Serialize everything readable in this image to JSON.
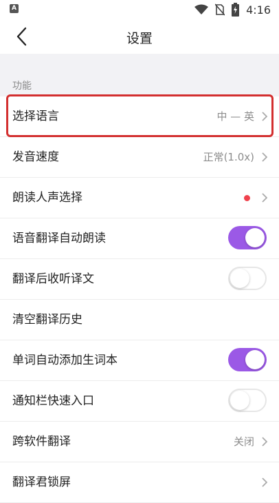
{
  "status_bar": {
    "left_icon_text": "A",
    "icons": [
      "wifi-icon",
      "no-sim-icon",
      "battery-charging-icon"
    ],
    "time": "4:16"
  },
  "header": {
    "title": "设置",
    "back_icon": "chevron-left-icon"
  },
  "section": {
    "label": "功能"
  },
  "rows": [
    {
      "label": "选择语言",
      "value": "中 — 英",
      "control": "chevron",
      "highlighted": true
    },
    {
      "label": "发音速度",
      "value": "正常(1.0x)",
      "control": "chevron"
    },
    {
      "label": "朗读人声选择",
      "value": "",
      "control": "dot-chevron",
      "dot_color": "#f0424d"
    },
    {
      "label": "语音翻译自动朗读",
      "control": "toggle",
      "state": "on"
    },
    {
      "label": "翻译后收听译文",
      "control": "toggle",
      "state": "off"
    },
    {
      "label": "清空翻译历史",
      "control": "none"
    },
    {
      "label": "单词自动添加生词本",
      "control": "toggle",
      "state": "on"
    },
    {
      "label": "通知栏快速入口",
      "control": "toggle",
      "state": "off"
    },
    {
      "label": "跨软件翻译",
      "value": "关闭",
      "control": "chevron"
    },
    {
      "label": "翻译君锁屏",
      "value": "",
      "control": "chevron"
    }
  ],
  "colors": {
    "accent_toggle": "#9b59e6",
    "highlight_border": "#d32f2f",
    "section_background": "#f2f2f5"
  }
}
